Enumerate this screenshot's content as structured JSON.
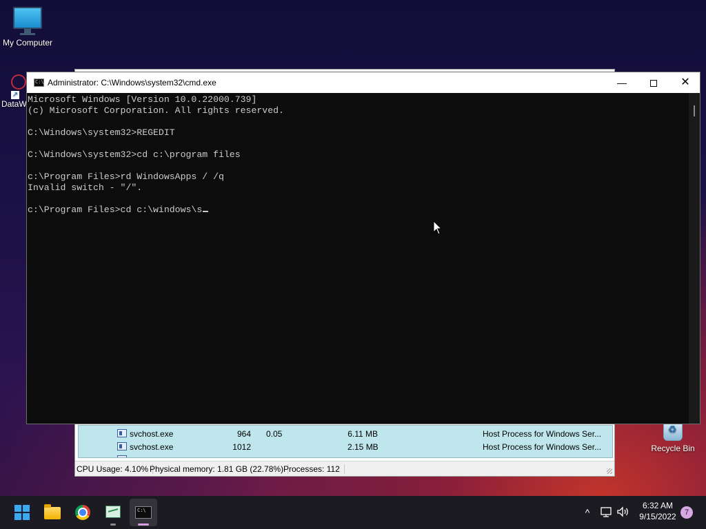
{
  "desktop": {
    "icons": [
      {
        "label": "My Computer"
      },
      {
        "label": "DataW"
      },
      {
        "label": "Recycle Bin"
      }
    ]
  },
  "task_manager": {
    "rows": [
      {
        "name": "svchost.exe",
        "pid": "964",
        "cpu": "0.05",
        "memory": "6.11 MB",
        "description": "Host Process for Windows Ser..."
      },
      {
        "name": "svchost.exe",
        "pid": "1012",
        "cpu": "",
        "memory": "2.15 MB",
        "description": "Host Process for Windows Ser..."
      }
    ],
    "status": {
      "cpu": "CPU Usage: 4.10%",
      "memory": "Physical memory: 1.81 GB (22.78%)",
      "processes": "Processes: 112"
    }
  },
  "cmd": {
    "title": "Administrator: C:\\Windows\\system32\\cmd.exe",
    "icon_text": "C:\\",
    "buttons": {
      "minimize": "—",
      "close": "✕"
    },
    "lines": [
      "Microsoft Windows [Version 10.0.22000.739]",
      "(c) Microsoft Corporation. All rights reserved.",
      "",
      "C:\\Windows\\system32>REGEDIT",
      "",
      "C:\\Windows\\system32>cd c:\\program files",
      "",
      "c:\\Program Files>rd WindowsApps / /q",
      "Invalid switch - \"/\".",
      "",
      "c:\\Program Files>cd c:\\windows\\s"
    ]
  },
  "taskbar": {
    "apps": [
      {
        "name": "start-icon"
      },
      {
        "name": "file-explorer-icon"
      },
      {
        "name": "chrome-icon"
      },
      {
        "name": "task-manager-icon"
      },
      {
        "name": "command-prompt-icon"
      }
    ],
    "tray": {
      "chevron": "^",
      "time": "6:32 AM",
      "date": "9/15/2022",
      "notification_count": "7"
    }
  },
  "colors": {
    "console_bg": "#0c0c0c",
    "console_fg": "#cccccc",
    "taskbar_bg": "#1d1b22",
    "taskmgr_list_bg": "#bfe6ec",
    "notification_badge": "#d7a7e4"
  }
}
